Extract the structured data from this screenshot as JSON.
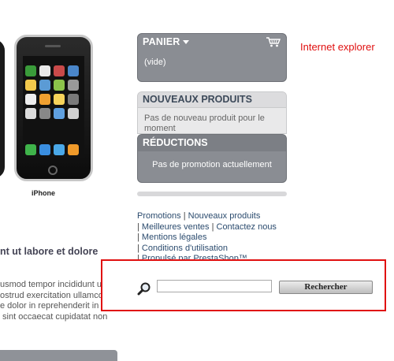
{
  "product": {
    "name": "iPhone"
  },
  "left_content": {
    "heading": "nt ut labore et dolore",
    "paragraph_lines": [
      "usmod tempor incididunt ut",
      "ostrud exercitation ullamco",
      "e dolor in reprehenderit in",
      " sint occaecat cupidatat non"
    ]
  },
  "cart_block": {
    "title": "PANIER",
    "empty_text": "(vide)"
  },
  "new_products_block": {
    "title": "NOUVEAUX PRODUITS",
    "text": "Pas de nouveau produit pour le moment"
  },
  "specials_block": {
    "title": "RÉDUCTIONS",
    "text": "Pas de promotion actuellement"
  },
  "footer": {
    "links": [
      "Promotions",
      "Nouveaux produits",
      "Meilleures ventes",
      "Contactez nous",
      "Mentions légales",
      "Conditions d'utilisation",
      "Propulsé par PrestaShop™"
    ],
    "separator": "|"
  },
  "search": {
    "input_value": "",
    "button_label": "Rechercher"
  },
  "annotation": {
    "label": "Internet explorer",
    "highlight_color": "#e01010"
  }
}
